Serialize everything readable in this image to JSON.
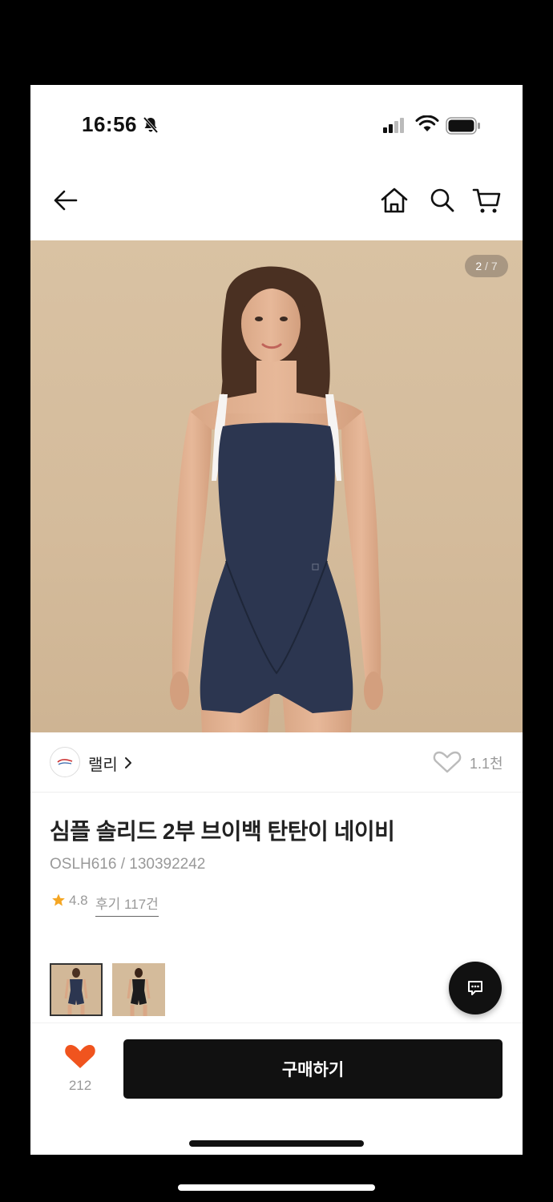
{
  "status_bar": {
    "time": "16:56"
  },
  "gallery": {
    "current": "2",
    "separator": "/",
    "total": "7"
  },
  "brand": {
    "name": "랠리",
    "wishlist_count": "1.1천"
  },
  "product": {
    "title": "심플 솔리드 2부 브이백 탄탄이 네이비",
    "code": "OSLH616 / 130392242",
    "rating": "4.8",
    "review_label": "후기 117건"
  },
  "bottom_bar": {
    "like_count": "212",
    "buy_label": "구매하기"
  },
  "colors": {
    "accent": "#f0541e",
    "star": "#f5a623",
    "primary_button": "#111111",
    "swimsuit_navy": "#2c3650"
  },
  "icons": [
    "bell-slash-icon",
    "signal-icon",
    "wifi-icon",
    "battery-icon",
    "back-arrow-icon",
    "home-icon",
    "search-icon",
    "cart-icon",
    "chevron-right-icon",
    "heart-outline-icon",
    "star-icon",
    "chat-icon",
    "heart-icon"
  ]
}
